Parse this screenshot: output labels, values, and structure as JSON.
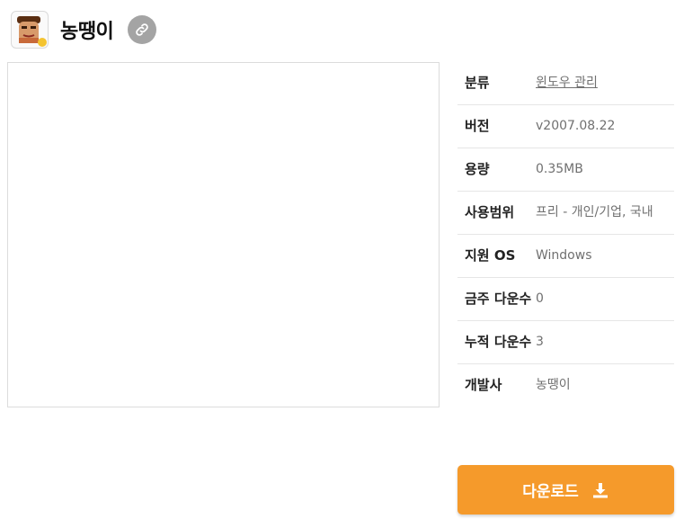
{
  "app": {
    "title": "농땡이",
    "icon": "app-face-icon",
    "link_icon": "link-icon"
  },
  "info": {
    "rows": [
      {
        "label": "분류",
        "value": "윈도우 관리",
        "is_link": true
      },
      {
        "label": "버전",
        "value": "v2007.08.22",
        "is_link": false
      },
      {
        "label": "용량",
        "value": "0.35MB",
        "is_link": false
      },
      {
        "label": "사용범위",
        "value": "프리 - 개인/기업, 국내",
        "is_link": false
      },
      {
        "label": "지원 OS",
        "value": "Windows",
        "is_link": false
      },
      {
        "label": "금주 다운수",
        "value": "0",
        "is_link": false
      },
      {
        "label": "누적 다운수",
        "value": "3",
        "is_link": false
      },
      {
        "label": "개발사",
        "value": "농땡이",
        "is_link": false
      }
    ]
  },
  "download": {
    "label": "다운로드",
    "icon": "download-icon"
  },
  "colors": {
    "accent": "#f59a2b",
    "link_button": "#a4a4a4"
  }
}
